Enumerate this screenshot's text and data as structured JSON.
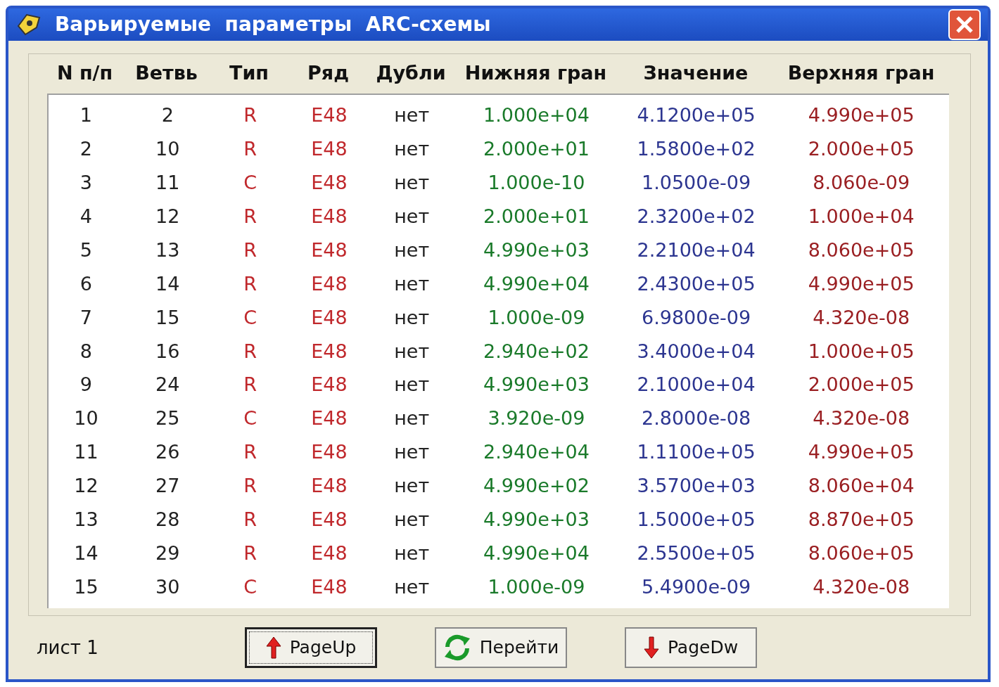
{
  "window": {
    "title": "Варьируемые  параметры  ARC-схемы"
  },
  "table": {
    "columns": [
      "N п/п",
      "Ветвь",
      "Тип",
      "Ряд",
      "Дубли",
      "Нижняя гран",
      "Значение",
      "Верхняя гран"
    ],
    "rows": [
      [
        "1",
        "2",
        "R",
        "E48",
        "нет",
        "1.000e+04",
        "4.1200e+05",
        "4.990e+05"
      ],
      [
        "2",
        "10",
        "R",
        "E48",
        "нет",
        "2.000e+01",
        "1.5800e+02",
        "2.000e+05"
      ],
      [
        "3",
        "11",
        "C",
        "E48",
        "нет",
        "1.000e-10",
        "1.0500e-09",
        "8.060e-09"
      ],
      [
        "4",
        "12",
        "R",
        "E48",
        "нет",
        "2.000e+01",
        "2.3200e+02",
        "1.000e+04"
      ],
      [
        "5",
        "13",
        "R",
        "E48",
        "нет",
        "4.990e+03",
        "2.2100e+04",
        "8.060e+05"
      ],
      [
        "6",
        "14",
        "R",
        "E48",
        "нет",
        "4.990e+04",
        "2.4300e+05",
        "4.990e+05"
      ],
      [
        "7",
        "15",
        "C",
        "E48",
        "нет",
        "1.000e-09",
        "6.9800e-09",
        "4.320e-08"
      ],
      [
        "8",
        "16",
        "R",
        "E48",
        "нет",
        "2.940e+02",
        "3.4000e+04",
        "1.000e+05"
      ],
      [
        "9",
        "24",
        "R",
        "E48",
        "нет",
        "4.990e+03",
        "2.1000e+04",
        "2.000e+05"
      ],
      [
        "10",
        "25",
        "C",
        "E48",
        "нет",
        "3.920e-09",
        "2.8000e-08",
        "4.320e-08"
      ],
      [
        "11",
        "26",
        "R",
        "E48",
        "нет",
        "2.940e+04",
        "1.1100e+05",
        "4.990e+05"
      ],
      [
        "12",
        "27",
        "R",
        "E48",
        "нет",
        "4.990e+02",
        "3.5700e+03",
        "8.060e+04"
      ],
      [
        "13",
        "28",
        "R",
        "E48",
        "нет",
        "4.990e+03",
        "1.5000e+05",
        "8.870e+05"
      ],
      [
        "14",
        "29",
        "R",
        "E48",
        "нет",
        "4.990e+04",
        "2.5500e+05",
        "8.060e+05"
      ],
      [
        "15",
        "30",
        "C",
        "E48",
        "нет",
        "1.000e-09",
        "5.4900e-09",
        "4.320e-08"
      ]
    ]
  },
  "status": {
    "page_label": "лист 1"
  },
  "buttons": [
    {
      "label": "PageUp",
      "kind": "up",
      "focused": true
    },
    {
      "label": "Перейти",
      "kind": "refresh",
      "focused": false
    },
    {
      "label": "PageDw",
      "kind": "down",
      "focused": false
    }
  ]
}
